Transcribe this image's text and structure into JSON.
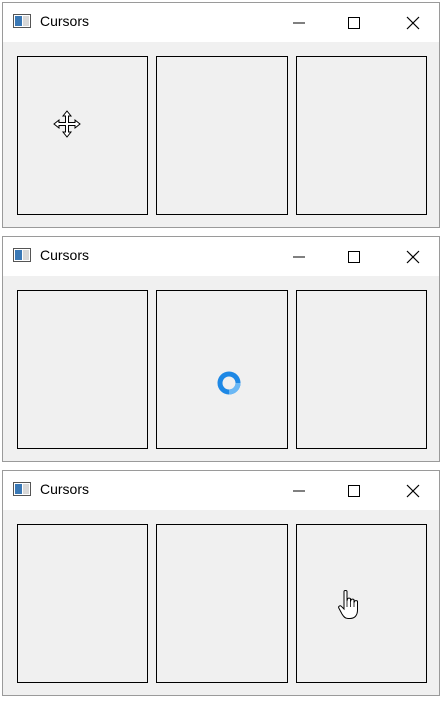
{
  "windows": [
    {
      "title": "Cursors",
      "cursor": "move-cursor-icon",
      "cursor_panel": 1
    },
    {
      "title": "Cursors",
      "cursor": "busy-cursor-icon",
      "cursor_panel": 2
    },
    {
      "title": "Cursors",
      "cursor": "hand-cursor-icon",
      "cursor_panel": 3
    }
  ],
  "colors": {
    "busy_ring": "#1e88e5",
    "panel_border": "#000000",
    "client_bg": "#f0f0f0"
  }
}
